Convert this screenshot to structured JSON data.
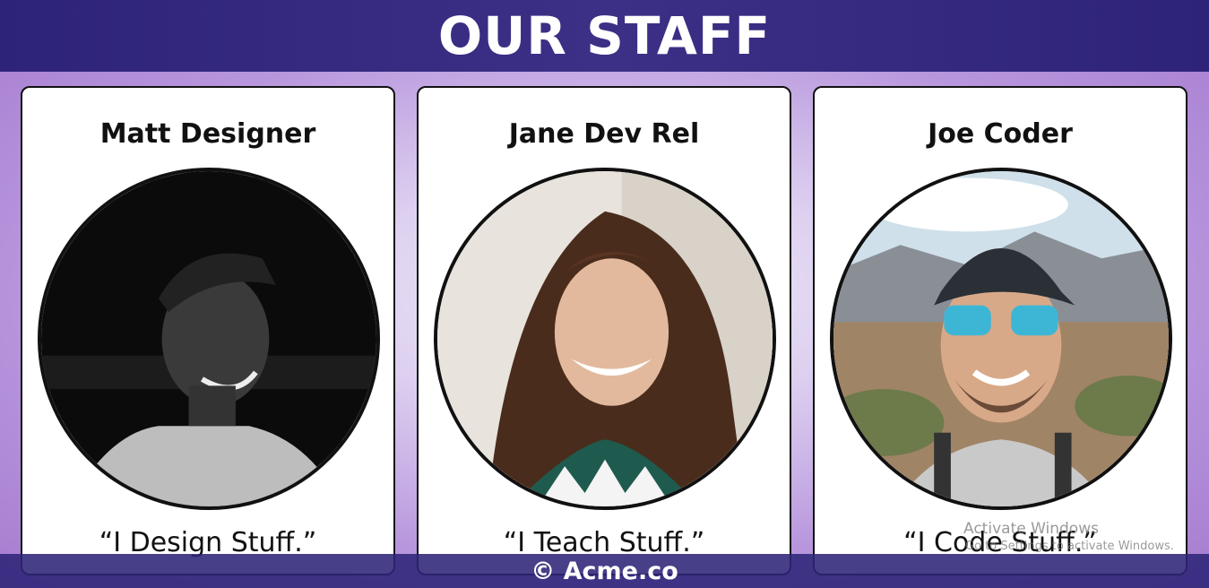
{
  "header": {
    "title": "OUR STAFF"
  },
  "staff": [
    {
      "name": "Matt Designer",
      "quote": "“I Design Stuff.”"
    },
    {
      "name": "Jane Dev Rel",
      "quote": "“I Teach Stuff.”"
    },
    {
      "name": "Joe Coder",
      "quote": "“I Code Stuff.”"
    }
  ],
  "footer": {
    "text": "© Acme.co"
  },
  "watermark": {
    "title": "Activate Windows",
    "subtitle": "Go to Settings to activate Windows."
  },
  "colors": {
    "header": "#2d2378",
    "footer": "#2e2478",
    "card_border": "#111111"
  }
}
